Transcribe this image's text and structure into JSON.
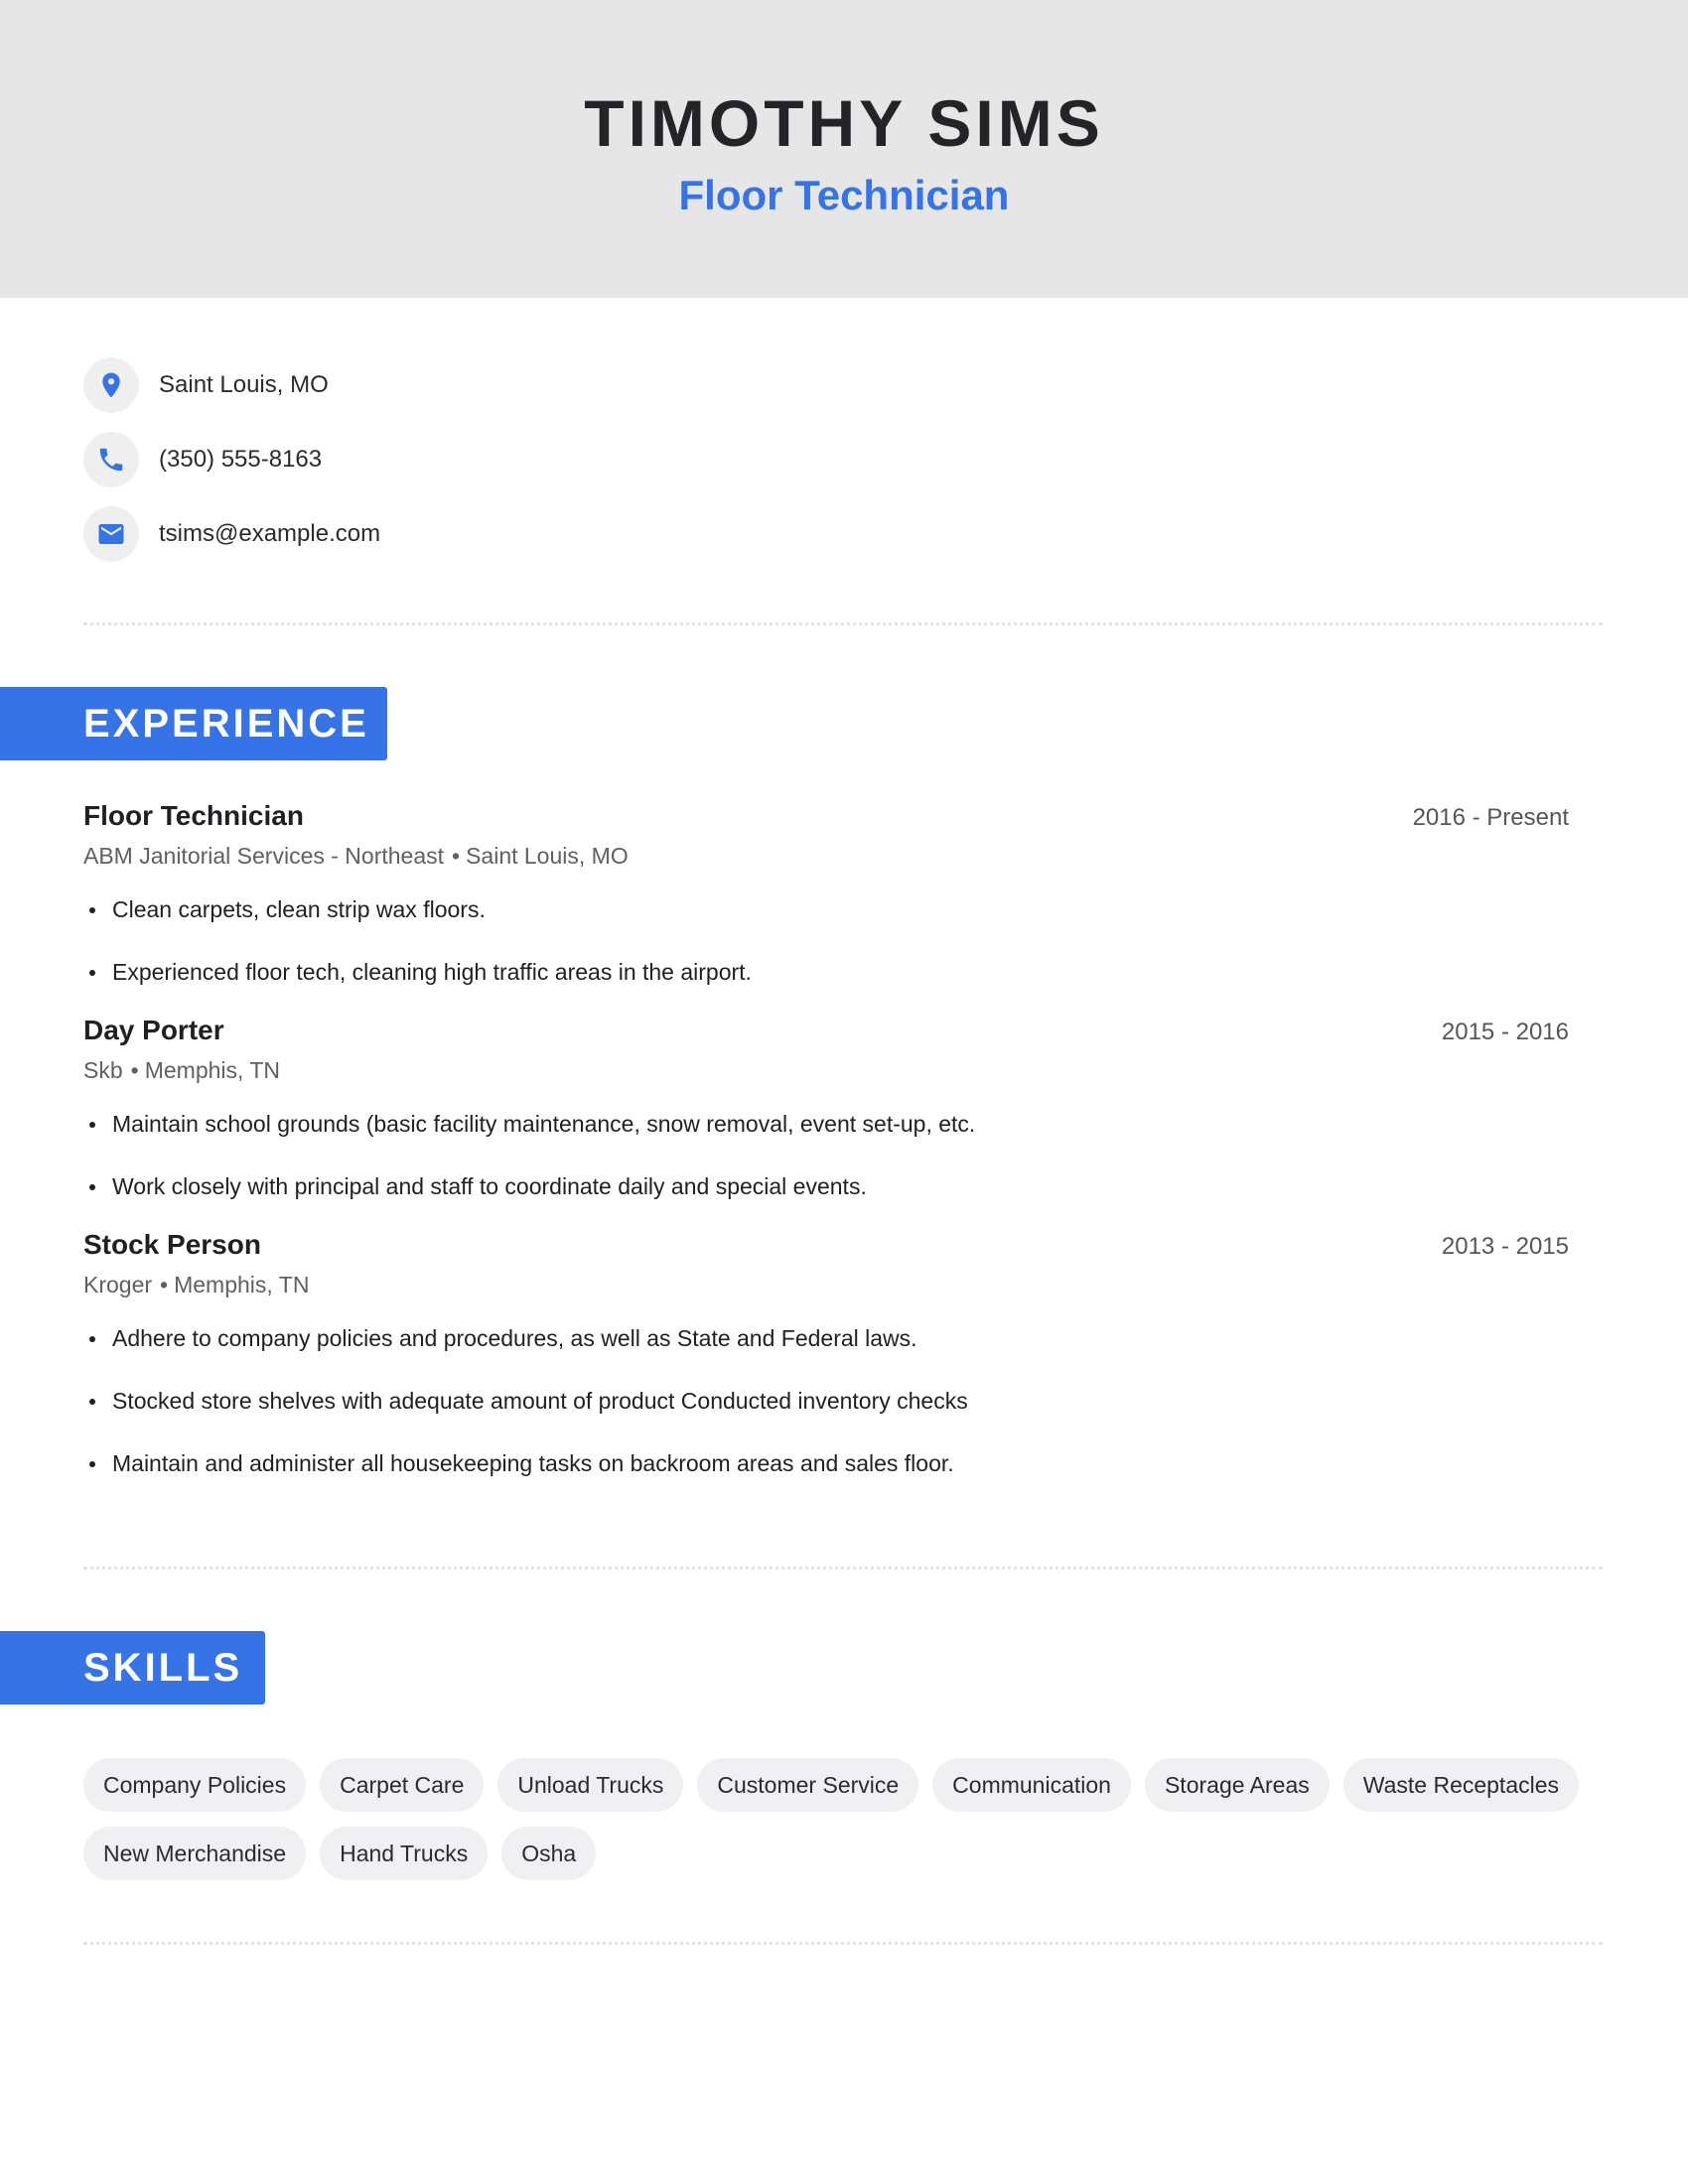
{
  "header": {
    "name": "TIMOTHY SIMS",
    "title": "Floor Technician"
  },
  "contact": [
    {
      "icon": "location-pin-icon",
      "text": "Saint Louis, MO"
    },
    {
      "icon": "phone-icon",
      "text": "(350) 555-8163"
    },
    {
      "icon": "email-icon",
      "text": "tsims@example.com"
    }
  ],
  "colors": {
    "accent": "#3573e6",
    "header_bg": "#e6e6e6",
    "chip_bg": "#f0f0f2"
  },
  "experience": {
    "heading": "EXPERIENCE",
    "jobs": [
      {
        "title": "Floor Technician",
        "dates": "2016 - Present",
        "company": "ABM Janitorial Services - Northeast",
        "separator": "•",
        "location": "Saint Louis, MO",
        "bullets": [
          "Clean carpets, clean strip wax floors.",
          "Experienced floor tech, cleaning high traffic areas in the airport."
        ]
      },
      {
        "title": "Day Porter",
        "dates": "2015 - 2016",
        "company": "Skb",
        "separator": "•",
        "location": "Memphis, TN",
        "bullets": [
          "Maintain school grounds (basic facility maintenance, snow removal, event set-up, etc.",
          "Work closely with principal and staff to coordinate daily and special events."
        ]
      },
      {
        "title": "Stock Person",
        "dates": "2013 - 2015",
        "company": "Kroger",
        "separator": "•",
        "location": "Memphis, TN",
        "bullets": [
          "Adhere to company policies and procedures, as well as State and Federal laws.",
          "Stocked store shelves with adequate amount of product Conducted inventory checks",
          "Maintain and administer all housekeeping tasks on backroom areas and sales floor."
        ]
      }
    ]
  },
  "skills": {
    "heading": "SKILLS",
    "items": [
      "Company Policies",
      "Carpet Care",
      "Unload Trucks",
      "Customer Service",
      "Communication",
      "Storage Areas",
      "Waste Receptacles",
      "New Merchandise",
      "Hand Trucks",
      "Osha"
    ]
  }
}
